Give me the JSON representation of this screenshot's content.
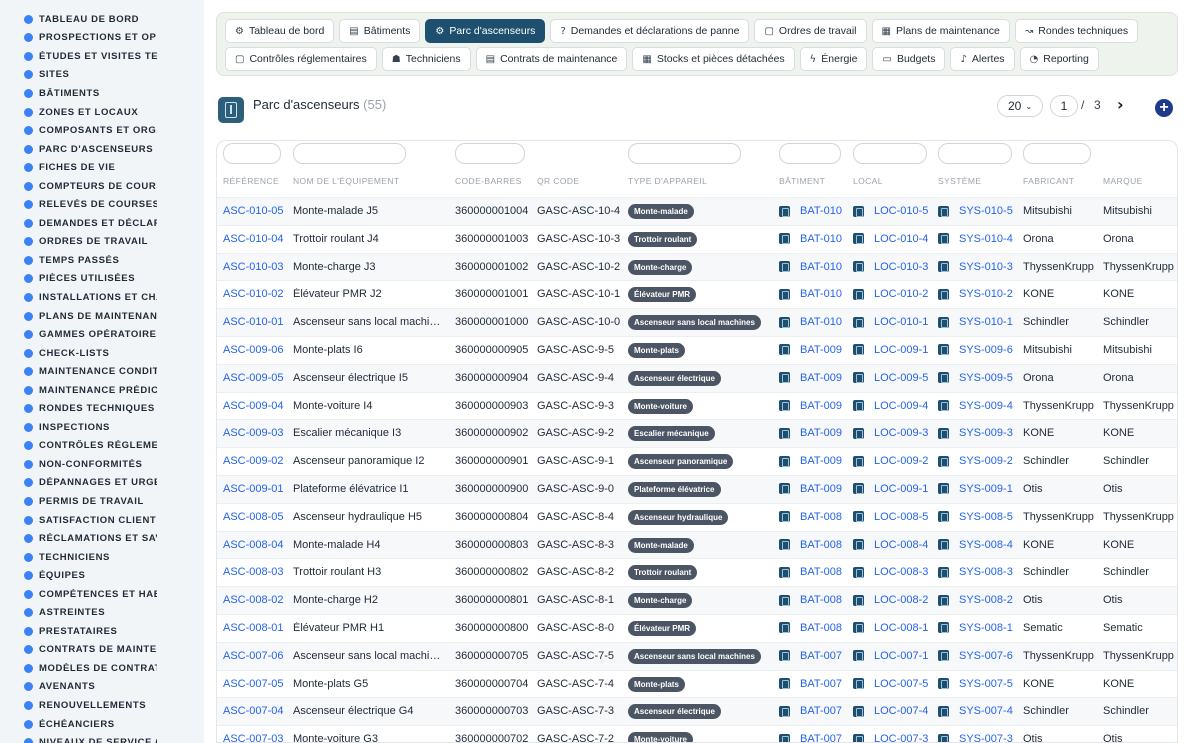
{
  "sidebar": {
    "items": [
      {
        "label": "TABLEAU DE BORD",
        "icon": "dashboard-icon"
      },
      {
        "label": "PROSPECTIONS ET OPPORTUNITÉS",
        "icon": "target-icon"
      },
      {
        "label": "ÉTUDES ET VISITES TECHNIQUES",
        "icon": "pencil-icon"
      },
      {
        "label": "SITES",
        "icon": "map-pin-icon"
      },
      {
        "label": "BÂTIMENTS",
        "icon": "building-icon"
      },
      {
        "label": "ZONES ET LOCAUX",
        "icon": "grid-icon"
      },
      {
        "label": "COMPOSANTS ET ORGANES",
        "icon": "sitemap-icon"
      },
      {
        "label": "PARC D'ASCENSEURS",
        "icon": "cogs-icon"
      },
      {
        "label": "FICHES DE VIE",
        "icon": "history-icon"
      },
      {
        "label": "COMPTEURS DE COURSES",
        "icon": "counter-icon"
      },
      {
        "label": "RELEVÉS DE COURSES",
        "icon": "clipboard-icon"
      },
      {
        "label": "DEMANDES ET DÉCLARATIONS",
        "icon": "question-icon"
      },
      {
        "label": "ORDRES DE TRAVAIL",
        "icon": "clipboard-list-icon"
      },
      {
        "label": "TEMPS PASSÉS",
        "icon": "clock-icon"
      },
      {
        "label": "PIÈCES UTILISÉES",
        "icon": "list-icon"
      },
      {
        "label": "INSTALLATIONS ET CHANGEMENTS",
        "icon": "wrench-icon"
      },
      {
        "label": "PLANS DE MAINTENANCE",
        "icon": "calendar-icon"
      },
      {
        "label": "GAMMES OPÉRATOIRES",
        "icon": "layers-icon"
      },
      {
        "label": "CHECK-LISTS",
        "icon": "checklist-icon"
      },
      {
        "label": "MAINTENANCE CONDITIONNELLE",
        "icon": "thermometer-icon"
      },
      {
        "label": "MAINTENANCE PRÉDICTIVE",
        "icon": "chart-icon"
      },
      {
        "label": "RONDES TECHNIQUES",
        "icon": "route-icon"
      },
      {
        "label": "INSPECTIONS",
        "icon": "search-icon"
      },
      {
        "label": "CONTRÔLES RÉGLEMENTAIRES",
        "icon": "shield-icon"
      },
      {
        "label": "NON-CONFORMITÉS",
        "icon": "alert-circle-icon"
      },
      {
        "label": "DÉPANNAGES ET URGENCES",
        "icon": "warning-icon"
      },
      {
        "label": "PERMIS DE TRAVAIL",
        "icon": "file-icon"
      },
      {
        "label": "SATISFACTION CLIENT",
        "icon": "smile-icon"
      },
      {
        "label": "RÉCLAMATIONS ET SAV",
        "icon": "comment-icon"
      },
      {
        "label": "TECHNICIENS",
        "icon": "user-hardhat-icon"
      },
      {
        "label": "ÉQUIPES",
        "icon": "users-icon"
      },
      {
        "label": "COMPÉTENCES ET HABILITATIONS",
        "icon": "certificate-icon"
      },
      {
        "label": "ASTREINTES",
        "icon": "phone-icon"
      },
      {
        "label": "PRESTATAIRES",
        "icon": "handshake-icon"
      },
      {
        "label": "CONTRATS DE MAINTENANCE",
        "icon": "contract-icon"
      },
      {
        "label": "MODÈLES DE CONTRATS",
        "icon": "copy-icon"
      },
      {
        "label": "AVENANTS",
        "icon": "file-plus-icon"
      },
      {
        "label": "RENOUVELLEMENTS",
        "icon": "refresh-icon"
      },
      {
        "label": "ÉCHÉANCIERS",
        "icon": "schedule-icon"
      },
      {
        "label": "NIVEAUX DE SERVICE (SLA)",
        "icon": "gauge-icon"
      }
    ]
  },
  "topnav": {
    "row1": [
      {
        "label": "Tableau de bord",
        "icon": "⚙",
        "name": "tab-tableau-de-bord"
      },
      {
        "label": "Bâtiments",
        "icon": "▤",
        "name": "tab-batiments"
      },
      {
        "label": "Parc d'ascenseurs",
        "icon": "⚙",
        "name": "tab-parc-ascenseurs",
        "active": true
      },
      {
        "label": "Demandes et déclarations de panne",
        "icon": "?",
        "name": "tab-demandes"
      },
      {
        "label": "Ordres de travail",
        "icon": "▢",
        "name": "tab-ordres-travail"
      },
      {
        "label": "Plans de maintenance",
        "icon": "▦",
        "name": "tab-plans-maintenance"
      },
      {
        "label": "Rondes techniques",
        "icon": "↝",
        "name": "tab-rondes-techniques"
      }
    ],
    "row2": [
      {
        "label": "Contrôles réglementaires",
        "icon": "▢",
        "name": "tab-controles"
      },
      {
        "label": "Techniciens",
        "icon": "☗",
        "name": "tab-techniciens"
      },
      {
        "label": "Contrats de maintenance",
        "icon": "▤",
        "name": "tab-contrats"
      },
      {
        "label": "Stocks et pièces détachées",
        "icon": "▦",
        "name": "tab-stocks"
      },
      {
        "label": "Énergie",
        "icon": "ϟ",
        "name": "tab-energie"
      },
      {
        "label": "Budgets",
        "icon": "▭",
        "name": "tab-budgets"
      },
      {
        "label": "Alertes",
        "icon": "♪",
        "name": "tab-alertes"
      },
      {
        "label": "Reporting",
        "icon": "◔",
        "name": "tab-reporting"
      }
    ]
  },
  "header": {
    "title": "Parc d'ascenseurs",
    "count": "(55)",
    "page_size": "20",
    "current_page": "1",
    "page_sep": "/",
    "total_pages": "3",
    "next_symbol": "›",
    "add_symbol": "+"
  },
  "table": {
    "columns": [
      "RÉFÉRENCE",
      "NOM DE L'ÉQUIPEMENT",
      "CODE-BARRES",
      "QR CODE",
      "TYPE D'APPAREIL",
      "BÂTIMENT",
      "LOCAL",
      "SYSTÈME",
      "FABRICANT",
      "MARQUE"
    ],
    "rows": [
      {
        "ref": "ASC-010-05",
        "name": "Monte-malade J5",
        "barcode": "360000001004",
        "qr": "GASC-ASC-10-4",
        "type": "Monte-malade",
        "bat": "BAT-010",
        "loc": "LOC-010-5",
        "sys": "SYS-010-5",
        "fab": "Mitsubishi",
        "mar": "Mitsubishi"
      },
      {
        "ref": "ASC-010-04",
        "name": "Trottoir roulant J4",
        "barcode": "360000001003",
        "qr": "GASC-ASC-10-3",
        "type": "Trottoir roulant",
        "bat": "BAT-010",
        "loc": "LOC-010-4",
        "sys": "SYS-010-4",
        "fab": "Orona",
        "mar": "Orona"
      },
      {
        "ref": "ASC-010-03",
        "name": "Monte-charge J3",
        "barcode": "360000001002",
        "qr": "GASC-ASC-10-2",
        "type": "Monte-charge",
        "bat": "BAT-010",
        "loc": "LOC-010-3",
        "sys": "SYS-010-3",
        "fab": "ThyssenKrupp",
        "mar": "ThyssenKrupp"
      },
      {
        "ref": "ASC-010-02",
        "name": "Élévateur PMR J2",
        "barcode": "360000001001",
        "qr": "GASC-ASC-10-1",
        "type": "Élévateur PMR",
        "bat": "BAT-010",
        "loc": "LOC-010-2",
        "sys": "SYS-010-2",
        "fab": "KONE",
        "mar": "KONE"
      },
      {
        "ref": "ASC-010-01",
        "name": "Ascenseur sans local machin…",
        "barcode": "360000001000",
        "qr": "GASC-ASC-10-0",
        "type": "Ascenseur sans local machines",
        "bat": "BAT-010",
        "loc": "LOC-010-1",
        "sys": "SYS-010-1",
        "fab": "Schindler",
        "mar": "Schindler"
      },
      {
        "ref": "ASC-009-06",
        "name": "Monte-plats I6",
        "barcode": "360000000905",
        "qr": "GASC-ASC-9-5",
        "type": "Monte-plats",
        "bat": "BAT-009",
        "loc": "LOC-009-1",
        "sys": "SYS-009-6",
        "fab": "Mitsubishi",
        "mar": "Mitsubishi"
      },
      {
        "ref": "ASC-009-05",
        "name": "Ascenseur électrique I5",
        "barcode": "360000000904",
        "qr": "GASC-ASC-9-4",
        "type": "Ascenseur électrique",
        "bat": "BAT-009",
        "loc": "LOC-009-5",
        "sys": "SYS-009-5",
        "fab": "Orona",
        "mar": "Orona"
      },
      {
        "ref": "ASC-009-04",
        "name": "Monte-voiture I4",
        "barcode": "360000000903",
        "qr": "GASC-ASC-9-3",
        "type": "Monte-voiture",
        "bat": "BAT-009",
        "loc": "LOC-009-4",
        "sys": "SYS-009-4",
        "fab": "ThyssenKrupp",
        "mar": "ThyssenKrupp"
      },
      {
        "ref": "ASC-009-03",
        "name": "Escalier mécanique I3",
        "barcode": "360000000902",
        "qr": "GASC-ASC-9-2",
        "type": "Escalier mécanique",
        "bat": "BAT-009",
        "loc": "LOC-009-3",
        "sys": "SYS-009-3",
        "fab": "KONE",
        "mar": "KONE"
      },
      {
        "ref": "ASC-009-02",
        "name": "Ascenseur panoramique I2",
        "barcode": "360000000901",
        "qr": "GASC-ASC-9-1",
        "type": "Ascenseur panoramique",
        "bat": "BAT-009",
        "loc": "LOC-009-2",
        "sys": "SYS-009-2",
        "fab": "Schindler",
        "mar": "Schindler"
      },
      {
        "ref": "ASC-009-01",
        "name": "Plateforme élévatrice I1",
        "barcode": "360000000900",
        "qr": "GASC-ASC-9-0",
        "type": "Plateforme élévatrice",
        "bat": "BAT-009",
        "loc": "LOC-009-1",
        "sys": "SYS-009-1",
        "fab": "Otis",
        "mar": "Otis"
      },
      {
        "ref": "ASC-008-05",
        "name": "Ascenseur hydraulique H5",
        "barcode": "360000000804",
        "qr": "GASC-ASC-8-4",
        "type": "Ascenseur hydraulique",
        "bat": "BAT-008",
        "loc": "LOC-008-5",
        "sys": "SYS-008-5",
        "fab": "ThyssenKrupp",
        "mar": "ThyssenKrupp"
      },
      {
        "ref": "ASC-008-04",
        "name": "Monte-malade H4",
        "barcode": "360000000803",
        "qr": "GASC-ASC-8-3",
        "type": "Monte-malade",
        "bat": "BAT-008",
        "loc": "LOC-008-4",
        "sys": "SYS-008-4",
        "fab": "KONE",
        "mar": "KONE"
      },
      {
        "ref": "ASC-008-03",
        "name": "Trottoir roulant H3",
        "barcode": "360000000802",
        "qr": "GASC-ASC-8-2",
        "type": "Trottoir roulant",
        "bat": "BAT-008",
        "loc": "LOC-008-3",
        "sys": "SYS-008-3",
        "fab": "Schindler",
        "mar": "Schindler"
      },
      {
        "ref": "ASC-008-02",
        "name": "Monte-charge H2",
        "barcode": "360000000801",
        "qr": "GASC-ASC-8-1",
        "type": "Monte-charge",
        "bat": "BAT-008",
        "loc": "LOC-008-2",
        "sys": "SYS-008-2",
        "fab": "Otis",
        "mar": "Otis"
      },
      {
        "ref": "ASC-008-01",
        "name": "Élévateur PMR H1",
        "barcode": "360000000800",
        "qr": "GASC-ASC-8-0",
        "type": "Élévateur PMR",
        "bat": "BAT-008",
        "loc": "LOC-008-1",
        "sys": "SYS-008-1",
        "fab": "Sematic",
        "mar": "Sematic"
      },
      {
        "ref": "ASC-007-06",
        "name": "Ascenseur sans local machin…",
        "barcode": "360000000705",
        "qr": "GASC-ASC-7-5",
        "type": "Ascenseur sans local machines",
        "bat": "BAT-007",
        "loc": "LOC-007-1",
        "sys": "SYS-007-6",
        "fab": "ThyssenKrupp",
        "mar": "ThyssenKrupp"
      },
      {
        "ref": "ASC-007-05",
        "name": "Monte-plats G5",
        "barcode": "360000000704",
        "qr": "GASC-ASC-7-4",
        "type": "Monte-plats",
        "bat": "BAT-007",
        "loc": "LOC-007-5",
        "sys": "SYS-007-5",
        "fab": "KONE",
        "mar": "KONE"
      },
      {
        "ref": "ASC-007-04",
        "name": "Ascenseur électrique G4",
        "barcode": "360000000703",
        "qr": "GASC-ASC-7-3",
        "type": "Ascenseur électrique",
        "bat": "BAT-007",
        "loc": "LOC-007-4",
        "sys": "SYS-007-4",
        "fab": "Schindler",
        "mar": "Schindler"
      },
      {
        "ref": "ASC-007-03",
        "name": "Monte-voiture G3",
        "barcode": "360000000702",
        "qr": "GASC-ASC-7-2",
        "type": "Monte-voiture",
        "bat": "BAT-007",
        "loc": "LOC-007-3",
        "sys": "SYS-007-3",
        "fab": "Otis",
        "mar": "Otis"
      }
    ]
  }
}
